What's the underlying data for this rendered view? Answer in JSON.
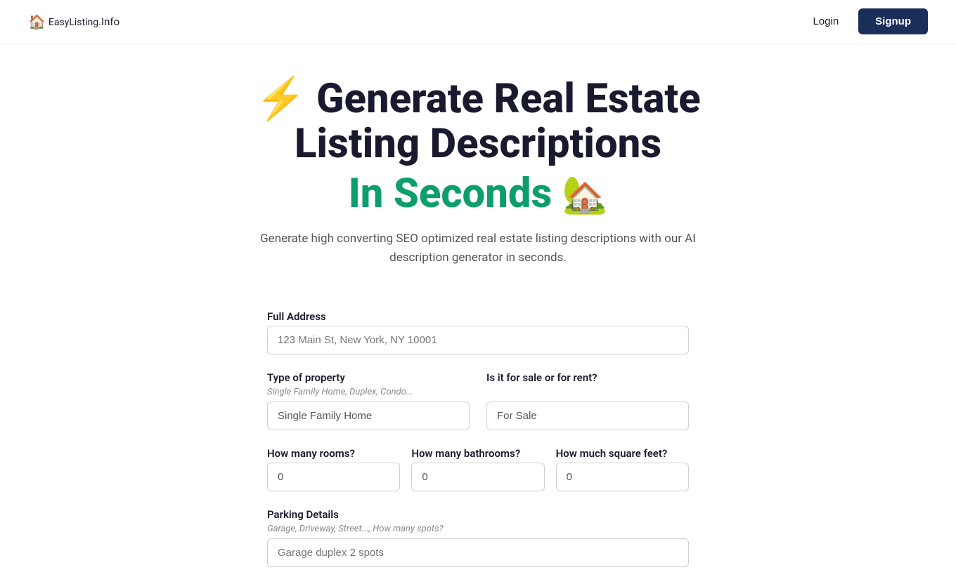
{
  "header": {
    "logo_icon": "🏠",
    "logo_brand": "EasyListing",
    "logo_suffix": ".Info",
    "login_label": "Login",
    "signup_label": "Signup"
  },
  "hero": {
    "lightning_emoji": "⚡",
    "line1": "Generate Real Estate",
    "line2": "Listing Descriptions",
    "line3_text": "In Seconds",
    "line3_emoji": "🏡",
    "description": "Generate high converting SEO optimized real estate listing descriptions with our AI description generator in seconds."
  },
  "form": {
    "address_label": "Full Address",
    "address_placeholder": "123 Main St, New York, NY 10001",
    "property_type_label": "Type of property",
    "property_type_hint": "Single Family Home, Duplex, Condo...",
    "property_type_value": "Single Family Home",
    "sale_rent_label": "Is it for sale or for rent?",
    "sale_rent_value": "For Sale",
    "rooms_label": "How many rooms?",
    "rooms_value": "0",
    "bathrooms_label": "How many bathrooms?",
    "bathrooms_value": "0",
    "sqft_label": "How much square feet?",
    "sqft_value": "0",
    "parking_label": "Parking Details",
    "parking_hint": "Garage, Driveway, Street..., How many spots?",
    "parking_placeholder": "Garage duplex 2 spots"
  }
}
